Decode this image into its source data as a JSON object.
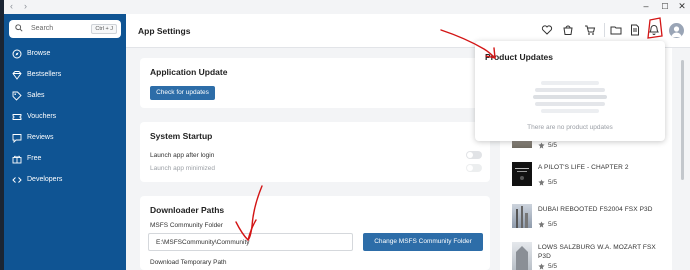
{
  "window": {
    "back": "‹",
    "forward": "›",
    "minimize": "–",
    "maximize": "☐",
    "close": "✕"
  },
  "search": {
    "placeholder": "Search",
    "shortcut": "Ctrl + J"
  },
  "sidebar": {
    "items": [
      {
        "label": "Browse",
        "icon": "compass-icon"
      },
      {
        "label": "Bestsellers",
        "icon": "diamond-icon"
      },
      {
        "label": "Sales",
        "icon": "tag-icon"
      },
      {
        "label": "Vouchers",
        "icon": "ticket-icon"
      },
      {
        "label": "Reviews",
        "icon": "chat-icon"
      },
      {
        "label": "Free",
        "icon": "gift-icon"
      },
      {
        "label": "Developers",
        "icon": "code-icon"
      }
    ]
  },
  "header": {
    "title": "App Settings",
    "icons": [
      "heart-icon",
      "bag-icon",
      "cart-icon",
      "folder-icon",
      "document-icon",
      "notifications-icon",
      "avatar"
    ]
  },
  "cards": {
    "application_update": {
      "title": "Application Update",
      "button": "Check for updates"
    },
    "system_startup": {
      "title": "System Startup",
      "launch_after_login": "Launch app after login",
      "launch_minimized": "Launch app minimized"
    },
    "downloader_paths": {
      "title": "Downloader Paths",
      "community_label": "MSFS Community Folder",
      "community_value": "E:\\MSFSCommunity\\Community",
      "change_button": "Change MSFS Community Folder",
      "temp_label": "Download Temporary Path"
    }
  },
  "product_updates": {
    "title": "Product Updates",
    "empty": "There are no product updates"
  },
  "products": [
    {
      "title": "",
      "version": "5/5"
    },
    {
      "title": "A PILOT'S LIFE - CHAPTER 2",
      "version": "5/5"
    },
    {
      "title": "DUBAI REBOOTED FS2004 FSX P3D",
      "version": "5/5"
    },
    {
      "title": "LOWS SALZBURG W.A. MOZART FSX P3D",
      "version": "5/5"
    }
  ],
  "colors": {
    "sidebar": "#0f5493",
    "button": "#2d6da8",
    "annotation": "#d31515"
  }
}
